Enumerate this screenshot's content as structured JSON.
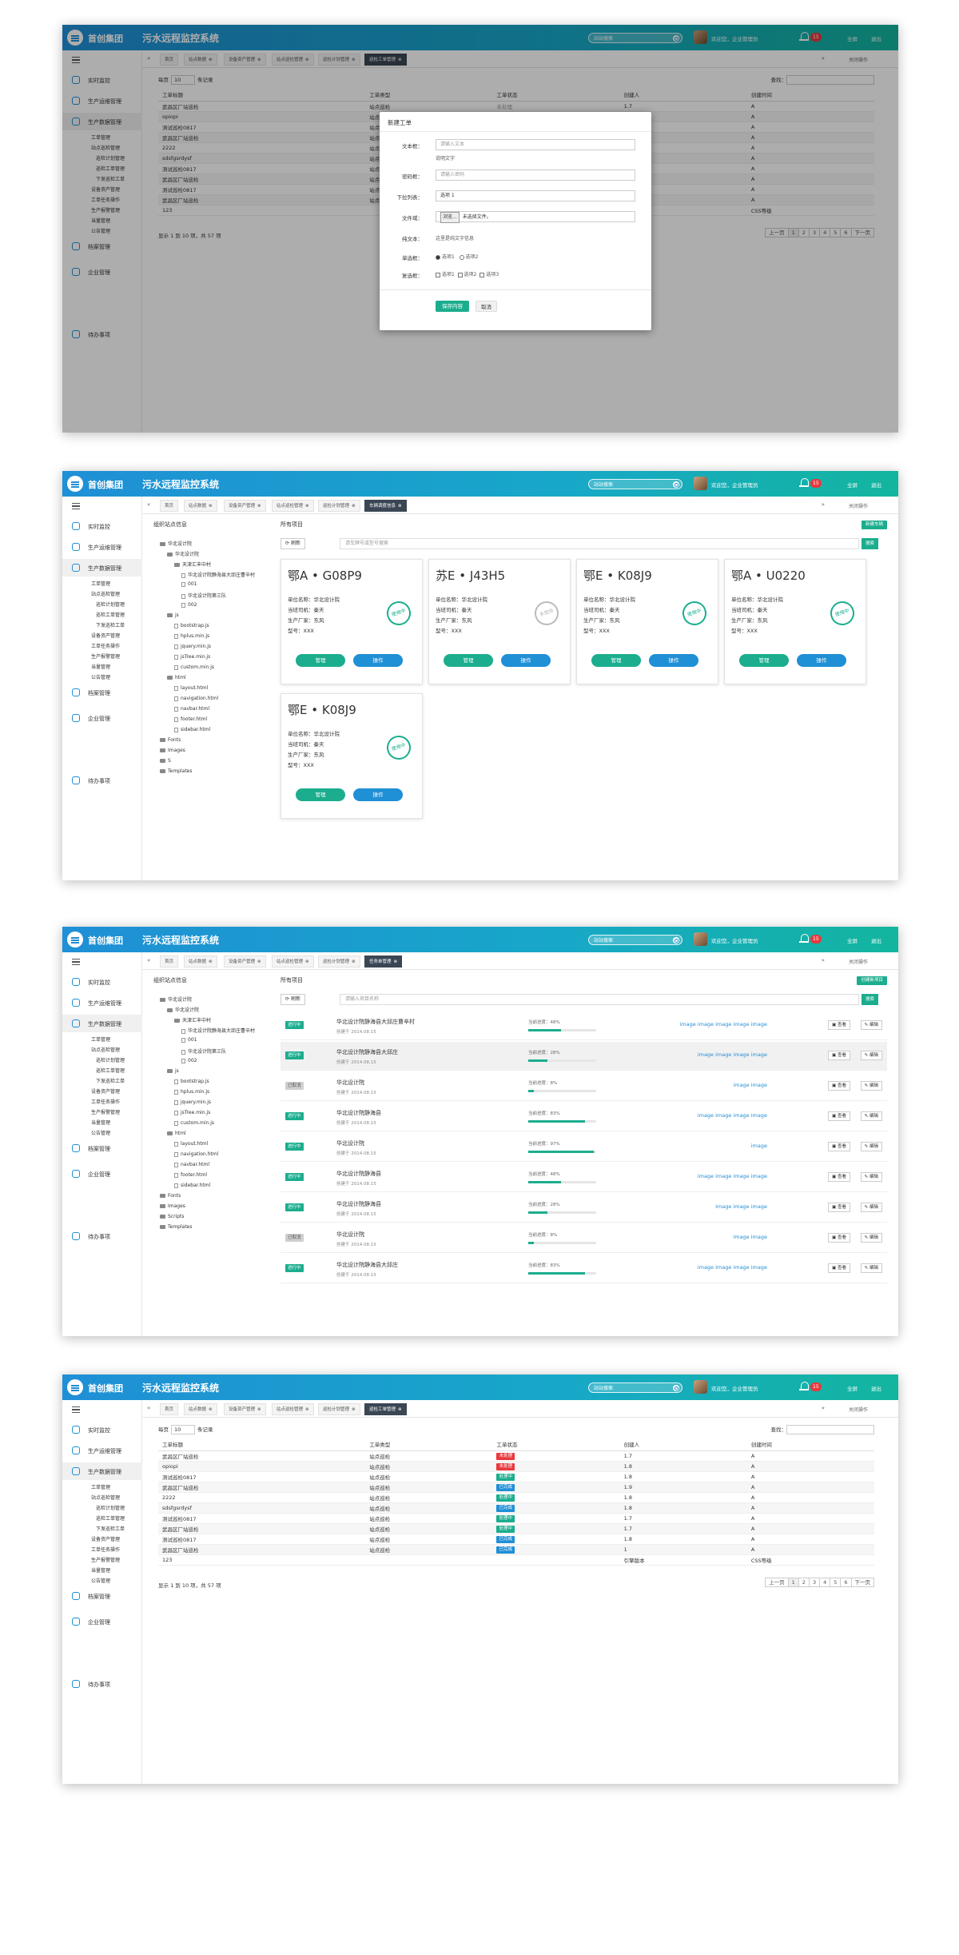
{
  "header": {
    "brand": "首创集团",
    "system_title": "污水远程监控系统",
    "search_placeholder": "站站搜索",
    "user_greeting": "欢迎您，企业管理员",
    "notification_count": "15",
    "fullscreen": "全屏",
    "logout": "退出"
  },
  "sidebar": {
    "items": [
      "实时监控",
      "生产运维管理",
      "生产数据管理",
      "档案管理",
      "企业管理",
      "待办事项"
    ],
    "subitems_a": [
      "工单管理",
      "站点巡检管理",
      "巡检计划管理",
      "巡检工单管理",
      "下发巡检工单",
      "设备资产管理",
      "工单任务操作",
      "生产报警管理",
      "当量管理",
      "公告管理"
    ],
    "subitems_b": [
      "工单管理",
      "站点巡检管理",
      "巡检计划管理",
      "巡检工单管理",
      "下发巡检工单",
      "设备资产管理",
      "工单任务操作",
      "生产报警管理",
      "当量管理",
      "公告管理"
    ]
  },
  "tabs": {
    "home": "首页",
    "set1": [
      "站点数据",
      "设备资产管理",
      "站点巡检管理",
      "巡检计划管理",
      "巡检工单管理"
    ],
    "set2": [
      "站点数据",
      "设备资产管理",
      "站点巡检管理",
      "巡检计划管理",
      "车辆调度信息"
    ],
    "set3": [
      "站点数据",
      "设备资产管理",
      "站点巡检管理",
      "巡检计划管理",
      "任务单管理"
    ],
    "set4": [
      "站点数据",
      "设备资产管理",
      "站点巡检管理",
      "巡检计划管理",
      "巡检工单管理"
    ],
    "close_ops": "关闭操作"
  },
  "table": {
    "page_size_prefix": "每页",
    "page_size": "10",
    "page_size_suffix": "条记录",
    "find_label": "查找：",
    "headers": [
      "工单标题",
      "工单类型",
      "工单状态",
      "创建人",
      "创建时间"
    ],
    "rows": [
      {
        "title": "武昌区厂站巡检",
        "type": "站点巡检",
        "status": "未处理",
        "creator": "1.7",
        "time": "A"
      },
      {
        "title": "opiopi",
        "type": "站点巡检",
        "status": "未处理",
        "creator": "1.8",
        "time": "A"
      },
      {
        "title": "测试巡检0817",
        "type": "站点巡检",
        "status": "处理中",
        "creator": "1.8",
        "time": "A"
      },
      {
        "title": "武昌区厂站巡检",
        "type": "站点巡检",
        "status": "已完成",
        "creator": "1.9",
        "time": "A"
      },
      {
        "title": "2222",
        "type": "站点巡检",
        "status": "处理中",
        "creator": "1.8",
        "time": "A"
      },
      {
        "title": "sdsfgsrdysf",
        "type": "站点巡检",
        "status": "已完成",
        "creator": "1.8",
        "time": "A"
      },
      {
        "title": "测试巡检0817",
        "type": "站点巡检",
        "status": "处理中",
        "creator": "1.7",
        "time": "A"
      },
      {
        "title": "武昌区厂站巡检",
        "type": "站点巡检",
        "status": "处理中",
        "creator": "1.7",
        "time": "A"
      },
      {
        "title": "测试巡检0817",
        "type": "站点巡检",
        "status": "已完成",
        "creator": "1.8",
        "time": "A"
      },
      {
        "title": "武昌区厂站巡检",
        "type": "站点巡检",
        "status": "已完成",
        "creator": "1",
        "time": "A"
      },
      {
        "title": "123",
        "type": "",
        "status": "",
        "creator": "引擎版本",
        "time": "CSS等级"
      }
    ],
    "info": "显示 1 到 10 项，共 57 项",
    "pager": [
      "上一页",
      "1",
      "2",
      "3",
      "4",
      "5",
      "6",
      "下一页"
    ]
  },
  "status_colors": {
    "未处理": "#e8383d",
    "处理中": "#1bad8e",
    "已完成": "#1f8fd6"
  },
  "modal": {
    "title": "新建工单",
    "labels": [
      "文本框：",
      "密码框：",
      "下拉列表：",
      "文件域：",
      "纯文本：",
      "单选框：",
      "复选框："
    ],
    "text_placeholder": "请输入文本",
    "text_hint": "说明文字",
    "password_placeholder": "请输入密码",
    "select_value": "选项 1",
    "file_button": "浏览...",
    "file_text": "未选择文件。",
    "plain_text": "这里是纯文字信息",
    "radios": [
      "选项1",
      "选项2"
    ],
    "checkboxes": [
      "选项1",
      "选项2",
      "选项3"
    ],
    "save": "保存内容",
    "cancel": "取消"
  },
  "tree": {
    "title": "组织站点信息",
    "nodes": [
      "华北设计院",
      "华北设计院",
      "天津汇丰中村",
      "华北设计院静海县大邱庄曹辛村",
      "001",
      "华北设计院第三队",
      "002",
      "js",
      "bootstrap.js",
      "hplus.min.js",
      "jquery.min.js",
      "jsTree.min.js",
      "custom.min.js",
      "html",
      "layout.html",
      "navigation.html",
      "navbar.html",
      "footer.html",
      "sidebar.html",
      "Fonts",
      "Images",
      "S",
      "Templates"
    ],
    "nodes3": [
      "华北设计院",
      "华北设计院",
      "天津汇丰中村",
      "华北设计院静海县大邱庄曹辛村",
      "001",
      "华北设计院第三队",
      "002",
      "js",
      "bootstrap.js",
      "hplus.min.js",
      "jquery.min.js",
      "jsTree.min.js",
      "custom.min.js",
      "html",
      "layout.html",
      "navigation.html",
      "navbar.html",
      "footer.html",
      "sidebar.html",
      "Fonts",
      "Images",
      "Scripts",
      "Templates"
    ]
  },
  "vehicles": {
    "panel_title": "所有项目",
    "add_button": "新建车辆",
    "refresh": "刷新",
    "search_placeholder": "请车牌号或型号搜索",
    "search_button": "搜索",
    "cards": [
      {
        "plate": "鄂A • G08P9",
        "unit": "单位名称：华北设计院",
        "driver": "当班司机：秦天",
        "maker": "生产厂家：东风",
        "model": "型号：XXX",
        "stamp": "使用中"
      },
      {
        "plate": "苏E • J43H5",
        "unit": "单位名称：华北设计院",
        "driver": "当班司机：秦天",
        "maker": "生产厂家：东风",
        "model": "型号：XXX",
        "stamp": "未使用"
      },
      {
        "plate": "鄂E • K08J9",
        "unit": "单位名称：华北设计院",
        "driver": "当班司机：秦天",
        "maker": "生产厂家：东风",
        "model": "型号：XXX",
        "stamp": "使用中"
      },
      {
        "plate": "鄂A • U0220",
        "unit": "单位名称：华北设计院",
        "driver": "当班司机：秦天",
        "maker": "生产厂家：东风",
        "model": "型号：XXX",
        "stamp": "使用中"
      },
      {
        "plate": "鄂E • K08J9",
        "unit": "单位名称：华北设计院",
        "driver": "当班司机：秦天",
        "maker": "生产厂家：东风",
        "model": "型号：XXX",
        "stamp": "使用中"
      }
    ],
    "manage": "管理",
    "operate": "操作"
  },
  "projects": {
    "panel_title": "所有项目",
    "add_button": "创建新项目",
    "refresh": "刷新",
    "search_placeholder": "请输入项目名称",
    "search_button": "搜索",
    "progress_prefix": "当前进度：",
    "view": "查看",
    "edit": "编辑",
    "rows": [
      {
        "badge": "进行中",
        "title": "华北设计院静海县大邱庄曹辛村",
        "date": "创建于 2014.08.15",
        "progress": 48,
        "images": "image image image image image",
        "hl": false
      },
      {
        "badge": "进行中",
        "title": "华北设计院静海县大邱庄",
        "date": "创建于 2014.08.15",
        "progress": 28,
        "images": "image image image image",
        "hl": true
      },
      {
        "badge": "已取消",
        "title": "华北设计院",
        "date": "创建于 2014.08.15",
        "progress": 8,
        "images": "image image",
        "hl": false
      },
      {
        "badge": "进行中",
        "title": "华北设计院静海县",
        "date": "创建于 2014.08.15",
        "progress": 83,
        "images": "image image image image",
        "hl": false
      },
      {
        "badge": "进行中",
        "title": "华北设计院",
        "date": "创建于 2014.08.15",
        "progress": 97,
        "images": "image",
        "hl": false
      },
      {
        "badge": "进行中",
        "title": "华北设计院静海县",
        "date": "创建于 2014.08.15",
        "progress": 48,
        "images": "image image image image",
        "hl": false
      },
      {
        "badge": "进行中",
        "title": "华北设计院静海县",
        "date": "创建于 2014.08.15",
        "progress": 28,
        "images": "image image image",
        "hl": false
      },
      {
        "badge": "已取消",
        "title": "华北设计院",
        "date": "创建于 2014.08.15",
        "progress": 8,
        "images": "image image",
        "hl": false
      },
      {
        "badge": "进行中",
        "title": "华北设计院静海县大邱庄",
        "date": "创建于 2014.08.15",
        "progress": 83,
        "images": "image image image image",
        "hl": false
      }
    ]
  }
}
